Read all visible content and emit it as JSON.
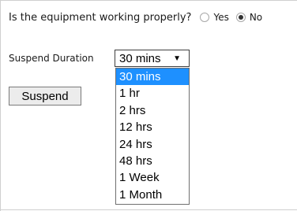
{
  "question": {
    "label": "Is the equipment working properly?",
    "options": [
      {
        "label": "Yes",
        "checked": false
      },
      {
        "label": "No",
        "checked": true
      }
    ]
  },
  "suspend": {
    "label": "Suspend Duration",
    "selected": "30 mins",
    "options": [
      "30 mins",
      "1 hr",
      "2 hrs",
      "12 hrs",
      "24 hrs",
      "48 hrs",
      "1 Week",
      "1 Month"
    ],
    "highlighted_index": 0,
    "highlight_color": "#1e90ff",
    "button_label": "Suspend",
    "caret_glyph": "▼"
  }
}
